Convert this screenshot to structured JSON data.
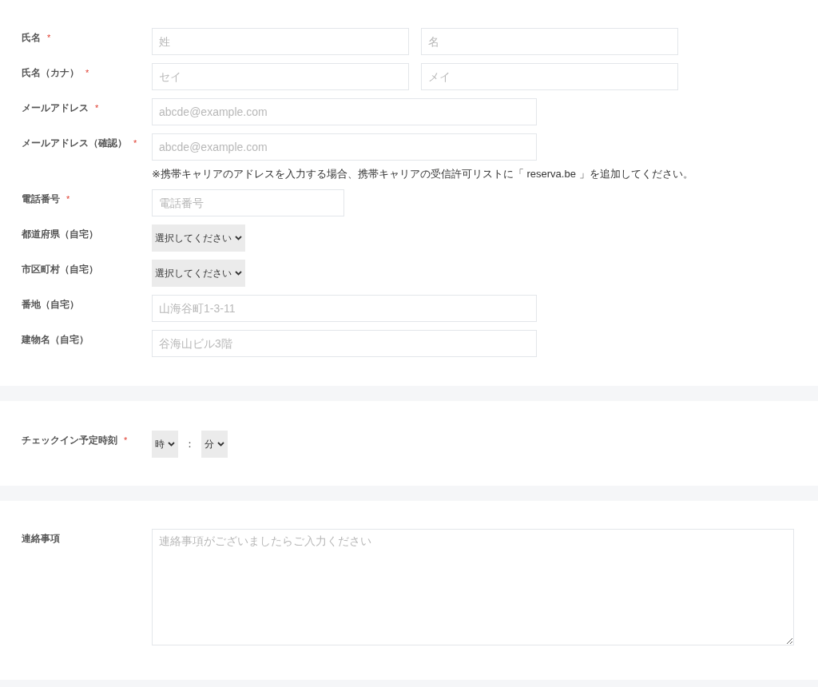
{
  "sections": [
    {
      "fields": [
        {
          "label": "氏名",
          "mark": "*",
          "kind": "name",
          "inputs": [
            {
              "placeholder": "姓"
            },
            {
              "placeholder": "名"
            }
          ]
        },
        {
          "label": "氏名（カナ）",
          "mark": "*",
          "kind": "name",
          "inputs": [
            {
              "placeholder": "セイ"
            },
            {
              "placeholder": "メイ"
            }
          ]
        },
        {
          "label": "メールアドレス",
          "mark": "*",
          "kind": "email",
          "inputs": [
            {
              "placeholder": "abcde@example.com"
            }
          ]
        },
        {
          "label": "メールアドレス（確認）",
          "mark": "*",
          "kind": "email",
          "inputs": [
            {
              "placeholder": "abcde@example.com"
            }
          ],
          "note": "※携帯キャリアのアドレスを入力する場合、携帯キャリアの受信許可リストに「 reserva.be 」を追加してください。"
        },
        {
          "label": "電話番号",
          "mark": "*",
          "kind": "tel",
          "inputs": [
            {
              "placeholder": "電話番号"
            }
          ]
        },
        {
          "label": "都道府県（自宅）",
          "kind": "select",
          "value": "選択してください"
        },
        {
          "label": "市区町村（自宅）",
          "kind": "select",
          "value": "選択してください"
        },
        {
          "label": "番地（自宅）",
          "kind": "text",
          "inputs": [
            {
              "placeholder": "山海谷町1-3-11"
            }
          ]
        },
        {
          "label": "建物名（自宅）",
          "kind": "text",
          "inputs": [
            {
              "placeholder": "谷海山ビル3階"
            }
          ]
        }
      ]
    },
    {
      "fields": [
        {
          "label": "チェックイン予定時刻",
          "mark": "*",
          "kind": "time",
          "hour": "時",
          "separator": "：",
          "minute": "分"
        }
      ]
    },
    {
      "fields": [
        {
          "label": "連絡事項",
          "kind": "textarea",
          "placeholder": "連絡事項がございましたらご入力ください"
        }
      ]
    }
  ]
}
